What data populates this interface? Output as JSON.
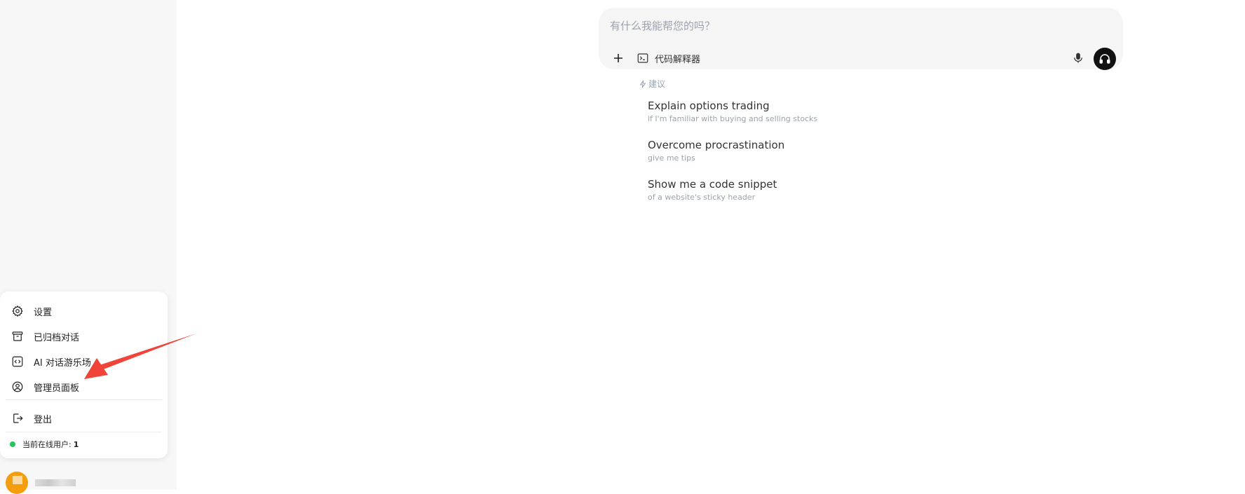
{
  "composer": {
    "placeholder": "有什么我能帮您的吗？",
    "tool_label": "代码解释器"
  },
  "suggestions": {
    "heading": "建议",
    "items": [
      {
        "title": "Explain options trading",
        "subtitle": "if I'm familiar with buying and selling stocks"
      },
      {
        "title": "Overcome procrastination",
        "subtitle": "give me tips"
      },
      {
        "title": "Show me a code snippet",
        "subtitle": "of a website's sticky header"
      }
    ]
  },
  "user_menu": {
    "items": [
      {
        "label": "设置",
        "icon": "gear-icon"
      },
      {
        "label": "已归档对话",
        "icon": "archive-icon"
      },
      {
        "label": "AI 对话游乐场",
        "icon": "code-icon"
      },
      {
        "label": "管理员面板",
        "icon": "user-circle-icon"
      },
      {
        "label": "登出",
        "icon": "logout-icon"
      }
    ],
    "online_label": "当前在线用户:",
    "online_count": "1"
  },
  "colors": {
    "sidebar_bg": "#f7f7f7",
    "online_dot": "#22c55e",
    "annotation_arrow": "#f04438",
    "voice_button": "#111111"
  }
}
